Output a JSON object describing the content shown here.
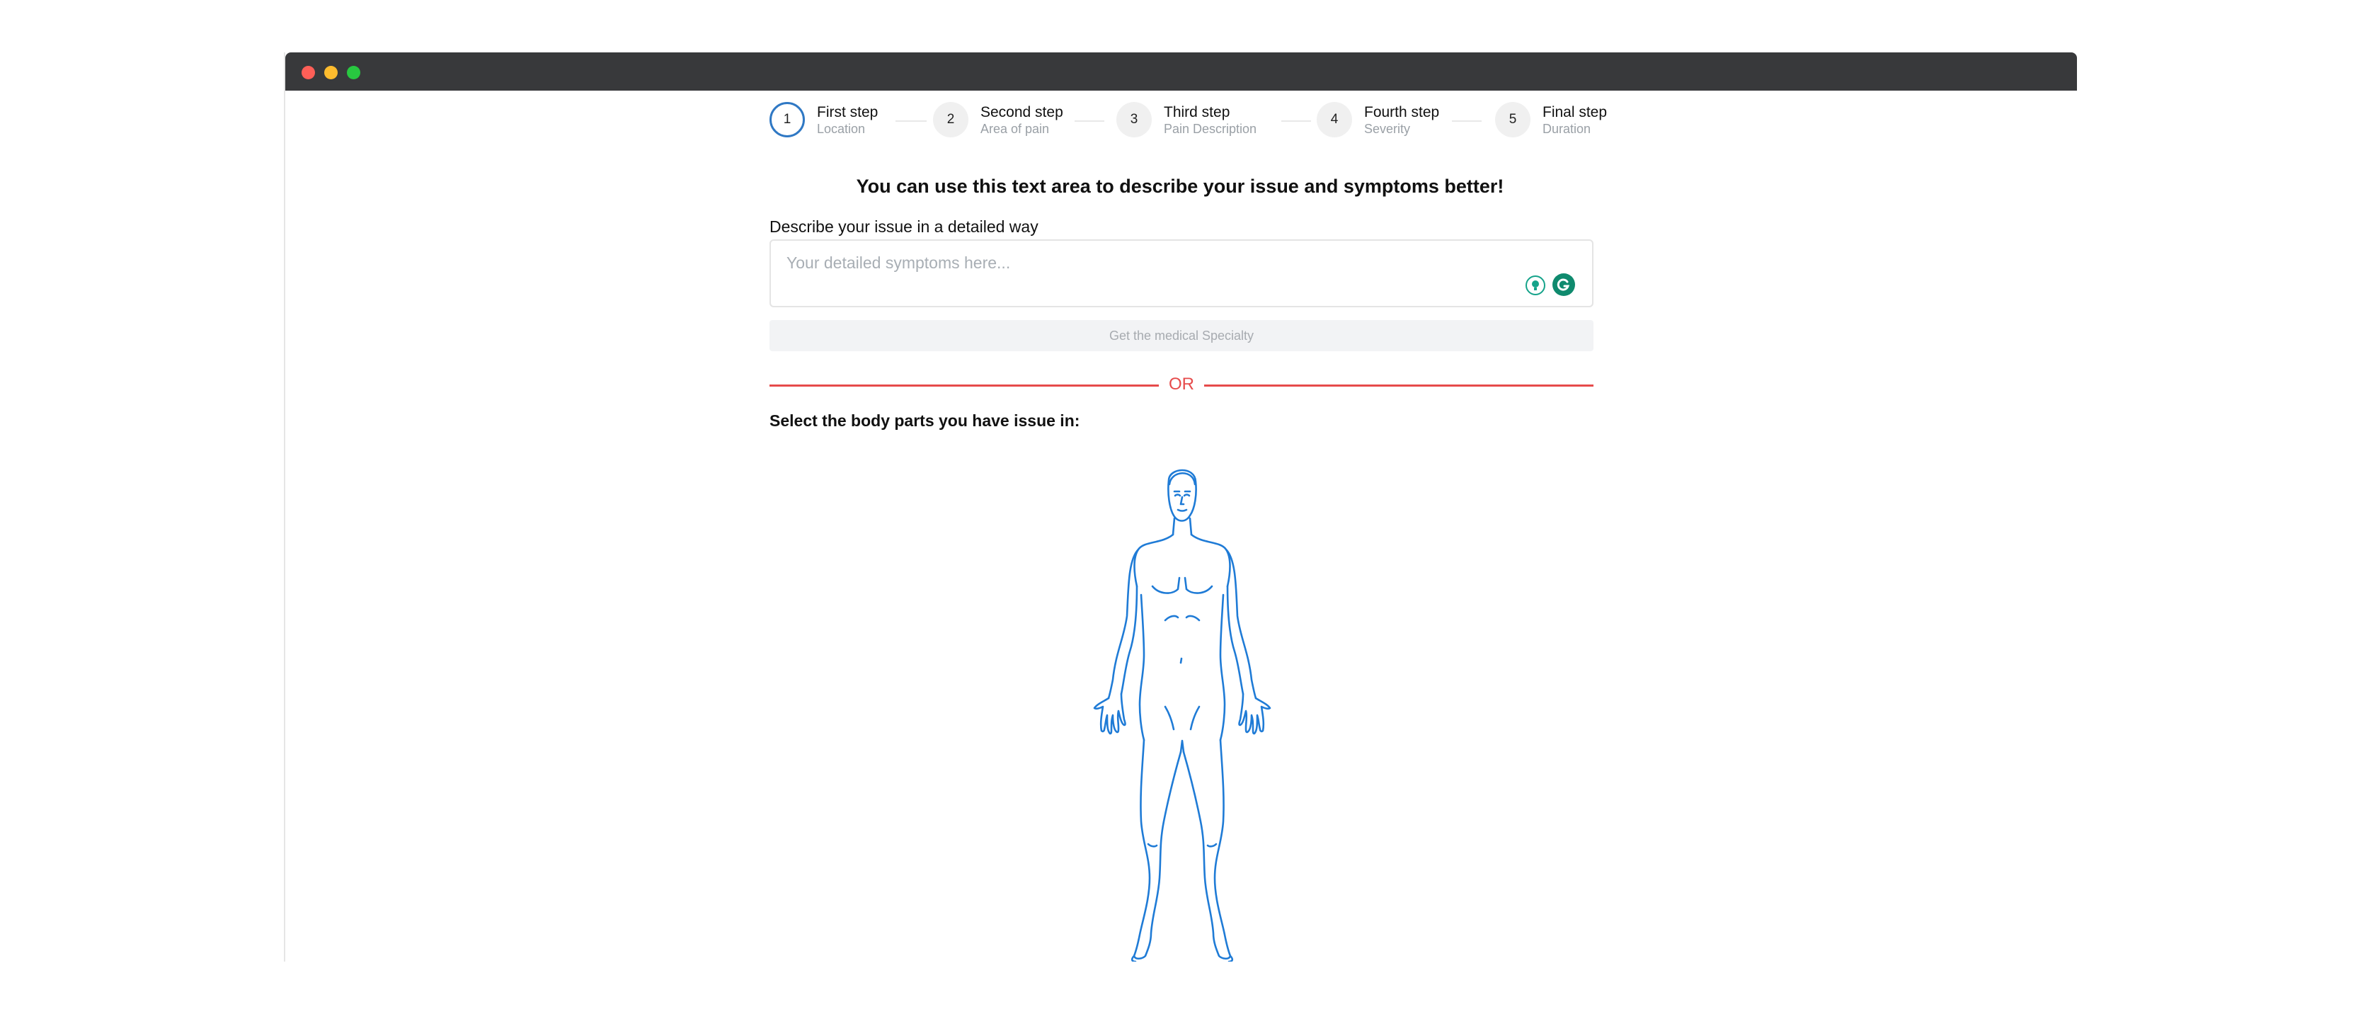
{
  "stepper": {
    "steps": [
      {
        "number": "1",
        "title": "First step",
        "subtitle": "Location",
        "active": true
      },
      {
        "number": "2",
        "title": "Second step",
        "subtitle": "Area of pain",
        "active": false
      },
      {
        "number": "3",
        "title": "Third step",
        "subtitle": "Pain Description",
        "active": false
      },
      {
        "number": "4",
        "title": "Fourth step",
        "subtitle": "Severity",
        "active": false
      },
      {
        "number": "5",
        "title": "Final step",
        "subtitle": "Duration",
        "active": false
      }
    ]
  },
  "main": {
    "heading": "You can use this text area to describe your issue and symptoms better!",
    "description_label": "Describe your issue in a detailed way",
    "description_placeholder": "Your detailed symptoms here...",
    "specialty_button": "Get the medical Specialty",
    "or_divider": "OR",
    "body_select_label": "Select the body parts you have issue in:"
  },
  "icons": {
    "window_controls": [
      "close-dot",
      "minimize-dot",
      "maximize-dot"
    ],
    "textarea_icons": [
      "grammarly-bulb-icon",
      "grammarly-g-icon"
    ],
    "figure": "human-body-outline"
  },
  "colors": {
    "accent_blue": "#2f78c4",
    "divider_red": "#e64b4b",
    "titlebar": "#38393b",
    "body_outline": "#1f7bd6"
  }
}
